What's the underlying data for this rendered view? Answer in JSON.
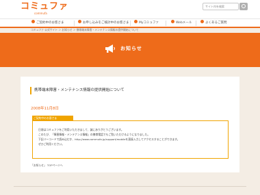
{
  "header": {
    "logo_text": "コミュファ",
    "logo_sub": "commufa",
    "search_placeholder": "サイト内を検索"
  },
  "nav": {
    "items": [
      {
        "label": "ご契約中のお客さま",
        "icon": "person-icon"
      },
      {
        "label": "お申し込みをご検討中のお客さま",
        "icon": "document-icon"
      },
      {
        "label": "Myコミュファ",
        "icon": "heart-icon"
      },
      {
        "label": "Webメール",
        "icon": "mail-icon"
      },
      {
        "label": "よくあるご質問",
        "icon": "question-icon"
      }
    ]
  },
  "breadcrumb": "コミュファ 公式サイト ＞ お知らせ ＞ 携帯端末障害・メンテナンス情報の提供開始について",
  "banner": {
    "title": "お知らせ",
    "icon": "megaphone-icon"
  },
  "article": {
    "title": "携帯端末障害・メンテナンス情報の提供開始について",
    "date": "2008年11月8日",
    "notice_label": "ご契約中のお客さま",
    "lines": [
      "日頃はコミュファをご利用いただきまして、誠にありがとうございます。",
      "このたび、「障害情報・メンテナンス情報」の携帯電話でもご覧いただけるようになりました。",
      "下記バーコードで読み込むか、http://www.commufa.jp/support/mobileを直接入力してアクセスすることができます。",
      "ぜひご利用ください。"
    ]
  },
  "footer": {
    "links": "「お知らせ」 TOPページへ"
  },
  "colors": {
    "brand_orange": "#ee6b1a",
    "accent_yellow": "#f0a400",
    "background": "#f4ede4"
  }
}
